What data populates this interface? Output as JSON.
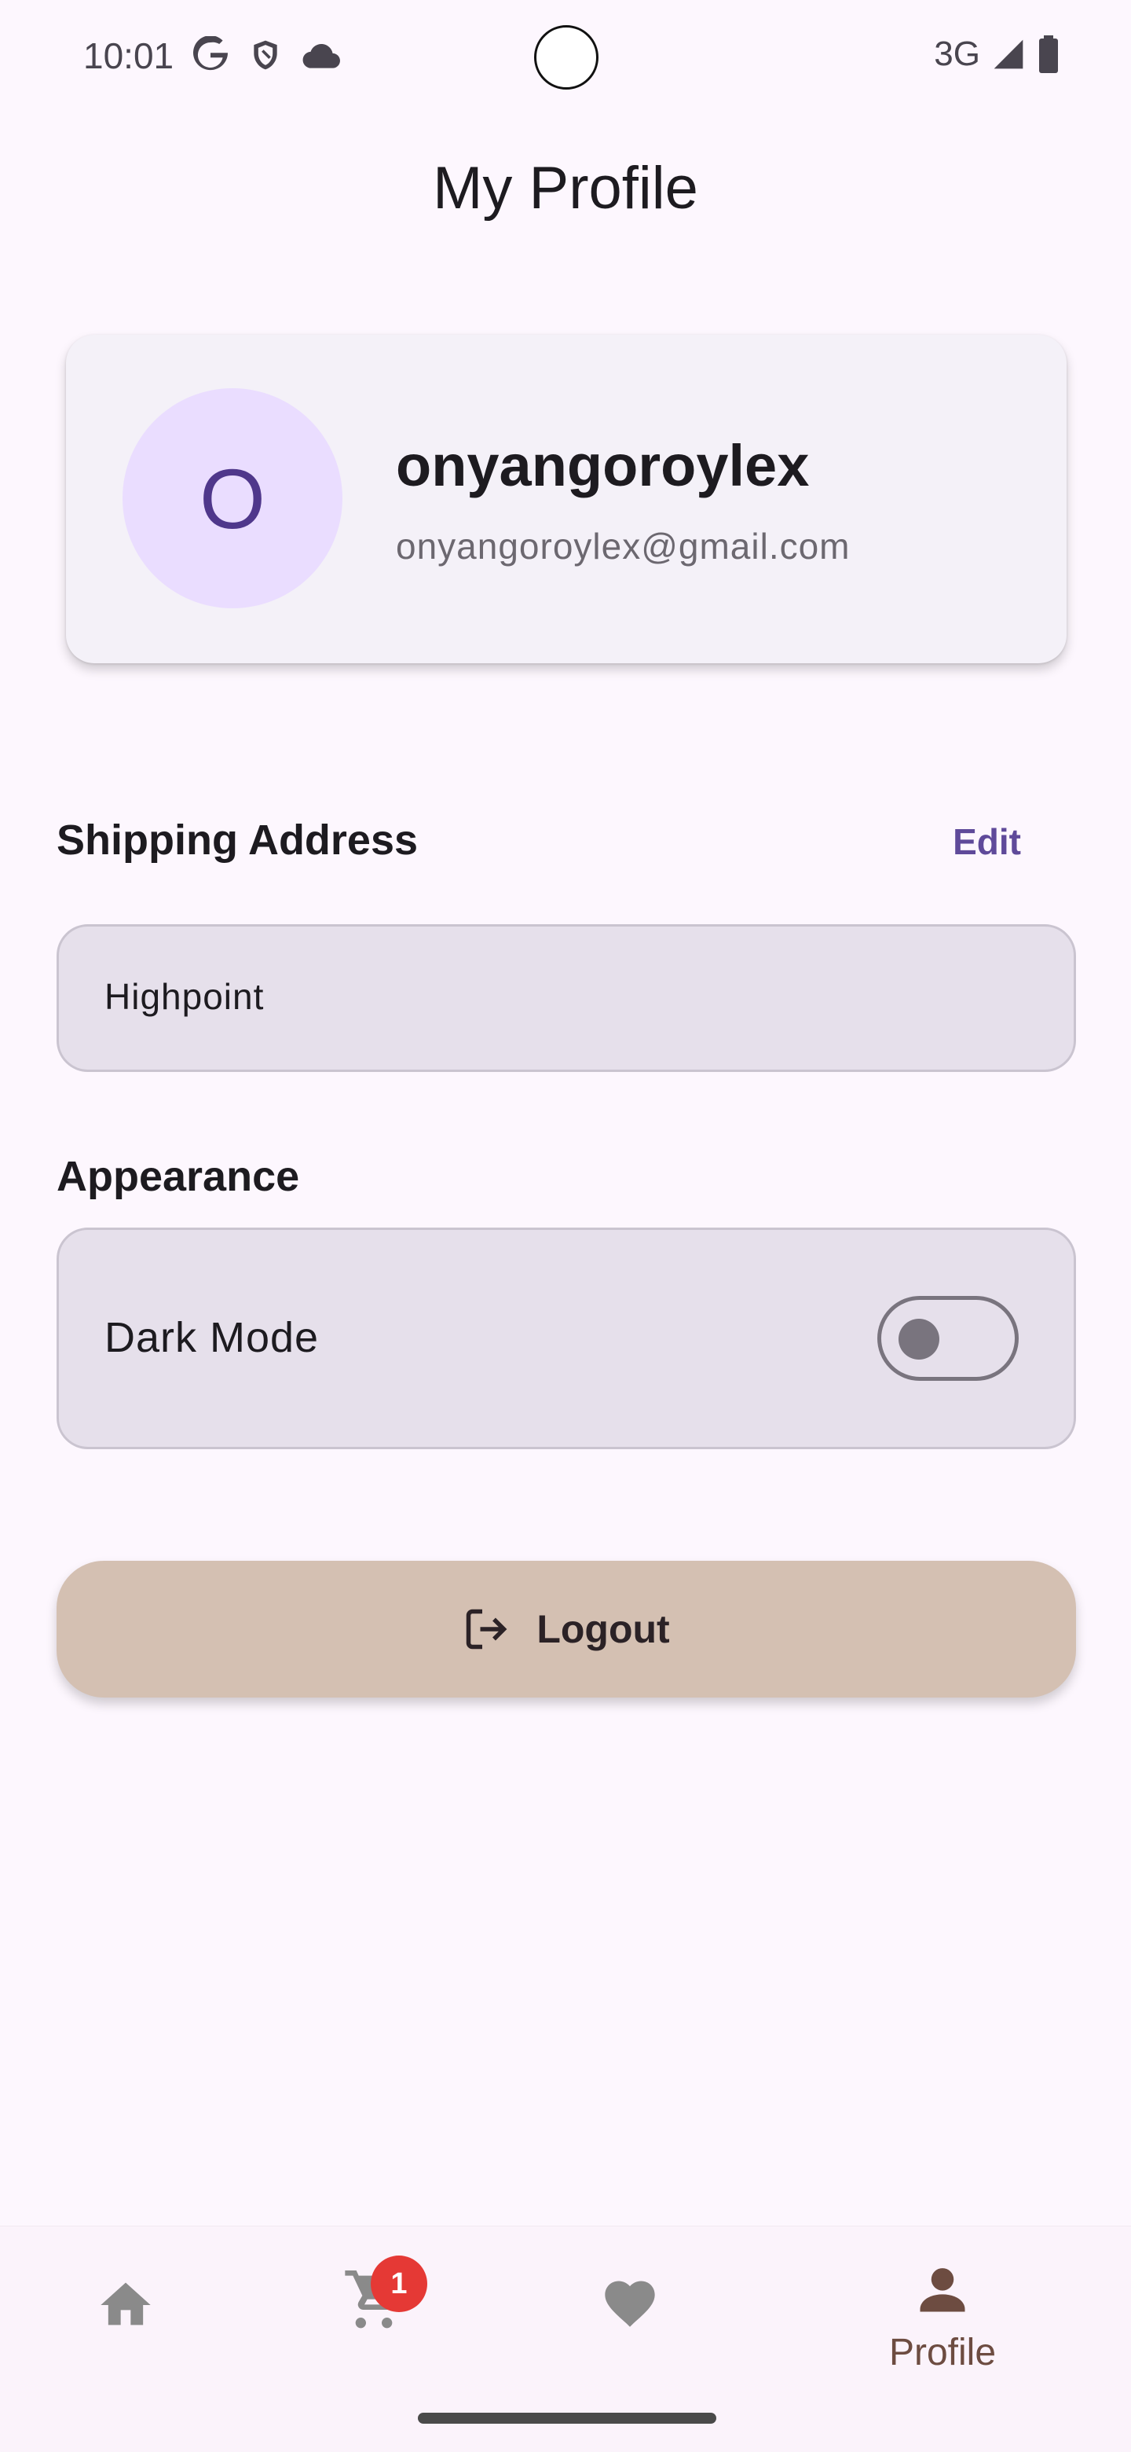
{
  "status_bar": {
    "time": "10:01",
    "network": "3G"
  },
  "header": {
    "title": "My Profile"
  },
  "profile": {
    "avatar_initial": "O",
    "username": "onyangoroylex",
    "email": "onyangoroylex@gmail.com"
  },
  "shipping": {
    "header": "Shipping Address",
    "edit_label": "Edit",
    "address": "Highpoint"
  },
  "appearance": {
    "header": "Appearance",
    "dark_mode_label": "Dark Mode",
    "dark_mode_on": false
  },
  "logout": {
    "label": "Logout"
  },
  "bottom_nav": {
    "cart_badge": "1",
    "profile_label": "Profile"
  },
  "colors": {
    "accent": "#5f4a9a",
    "avatar_bg": "#eaddff",
    "logout_bg": "#d4c0b2",
    "badge": "#e53935",
    "active_nav": "#6d4c41"
  },
  "icons": [
    "google-icon",
    "shield-icon",
    "cloud-icon",
    "signal-icon",
    "battery-icon",
    "home-icon",
    "cart-icon",
    "heart-icon",
    "person-icon",
    "logout-icon"
  ]
}
